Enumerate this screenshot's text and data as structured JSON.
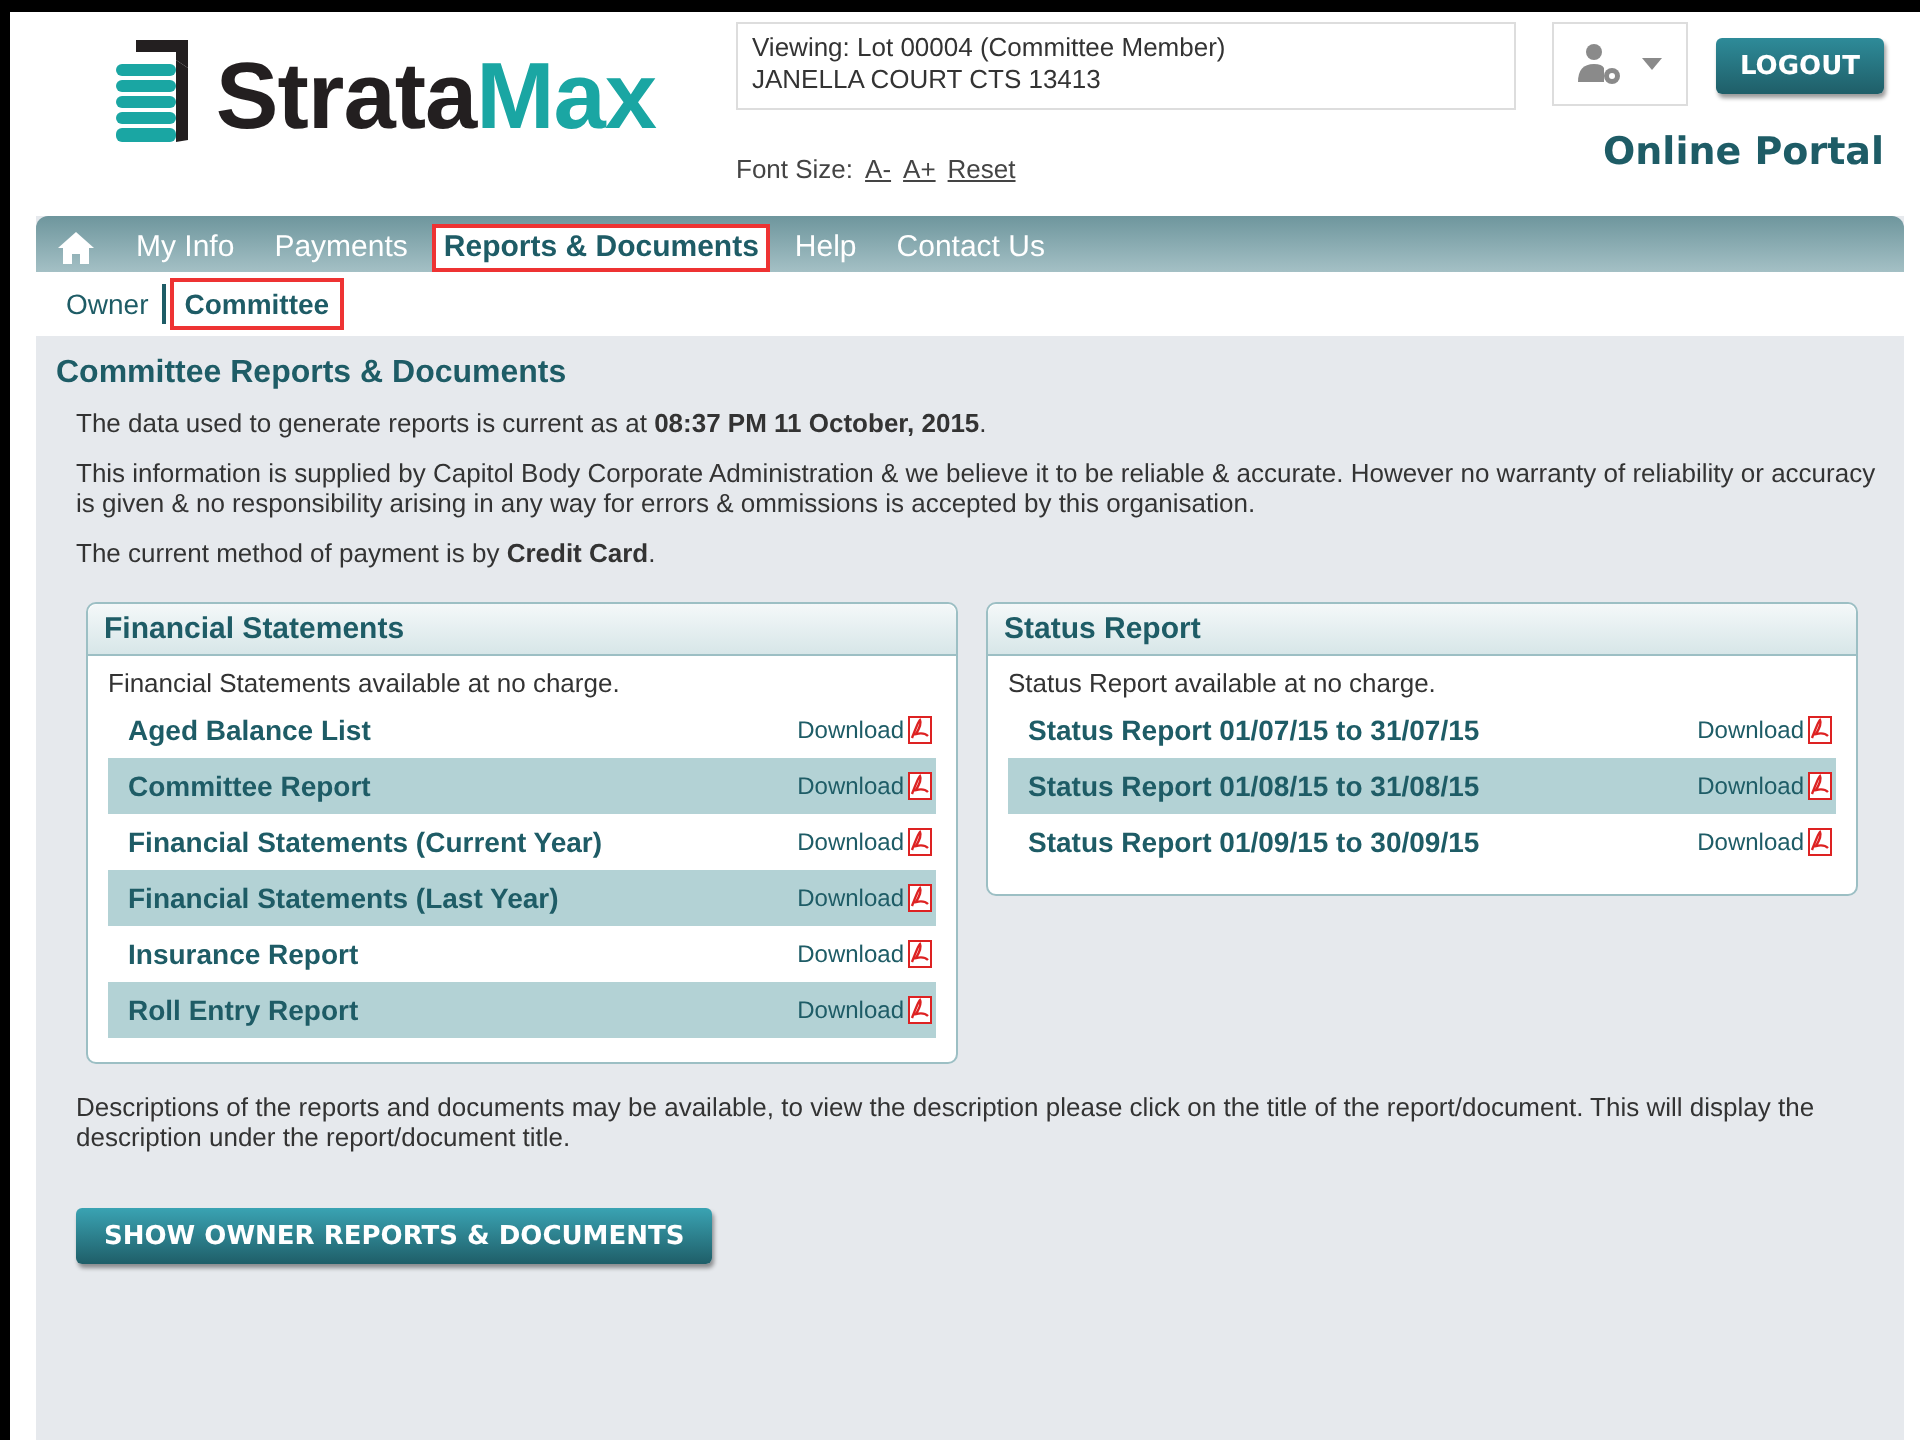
{
  "logo_parts": [
    "Strata",
    "Max"
  ],
  "viewing": {
    "line_1": "Viewing: Lot 00004 (Committee Member)",
    "line_2": "JANELLA COURT CTS 13413"
  },
  "font_size": {
    "label": "Font Size:",
    "links": [
      "A-",
      "A+",
      "Reset"
    ]
  },
  "logout": "LOGOUT",
  "portal_title": "Online Portal",
  "tabs": [
    {
      "label": "My Info",
      "selected": false
    },
    {
      "label": "Payments",
      "selected": false
    },
    {
      "label": "Reports & Documents",
      "selected": true
    },
    {
      "label": "Help",
      "selected": false
    },
    {
      "label": "Contact Us",
      "selected": false
    }
  ],
  "subtabs": [
    {
      "label": "Owner",
      "selected": false
    },
    {
      "label": "Committee",
      "selected": true
    }
  ],
  "heading": "Committee Reports & Documents",
  "paragraphs": [
    "The data used to generate reports is current as at **08:37 PM 11 October, 2015**.",
    "This information is supplied by Capitol Body Corporate Administration & we believe it to be reliable & accurate. However no warranty of reliability or accuracy is given & no responsibility arising in any way for errors & ommissions is accepted by this organisation.",
    "The current method of payment is by **Credit Card**."
  ],
  "panels": [
    {
      "title": "Financial Statements",
      "note": "Financial Statements available at no charge.",
      "items": [
        {
          "name": "Aged Balance List",
          "action": "Download"
        },
        {
          "name": "Committee Report",
          "action": "Download"
        },
        {
          "name": "Financial Statements (Current Year)",
          "action": "Download"
        },
        {
          "name": "Financial Statements (Last Year)",
          "action": "Download"
        },
        {
          "name": "Insurance Report",
          "action": "Download"
        },
        {
          "name": "Roll Entry Report",
          "action": "Download"
        }
      ]
    },
    {
      "title": "Status Report",
      "note": "Status Report available at no charge.",
      "items": [
        {
          "name": "Status Report 01/07/15 to 31/07/15",
          "action": "Download"
        },
        {
          "name": "Status Report 01/08/15 to 31/08/15",
          "action": "Download"
        },
        {
          "name": "Status Report 01/09/15 to 30/09/15",
          "action": "Download"
        }
      ]
    }
  ],
  "footer_note": "Descriptions of the reports and documents may be available, to view the description please click on the title of the report/document. This will display the description under the report/document title.",
  "show_button": "SHOW OWNER REPORTS & DOCUMENTS"
}
